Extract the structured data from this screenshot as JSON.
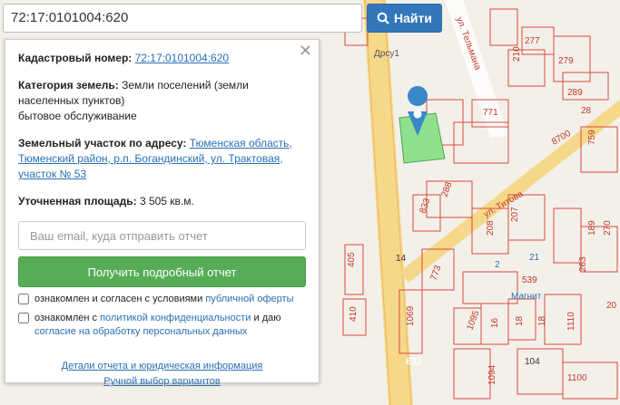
{
  "search": {
    "value": "72:17:0101004:620",
    "button_label": "Найти"
  },
  "panel": {
    "cadastral_label": "Кадастровый номер:",
    "cadastral_value": "72:17:0101004:620",
    "category_label": "Категория земель:",
    "category_value": "Земли поселений (земли населенных пунктов)",
    "usage": "бытовое обслуживание",
    "address_label": "Земельный участок по адресу:",
    "address_value": "Тюменская область, Тюменский район, р.п. Богандинский, ул. Трактовая, участок № 53",
    "area_label": "Уточненная площадь:",
    "area_value": "3 505 кв.м.",
    "email_placeholder": "Ваш email, куда отправить отчет",
    "report_button": "Получить подробный отчет",
    "consent1_text": "ознакомлен и согласен с условиями ",
    "consent1_link": "публичной оферты",
    "consent2_text": "ознакомлен с ",
    "consent2_link": "политикой конфиденциальности",
    "consent2_mid": " и даю ",
    "consent2_link2": "согласие на обработку персональных данных",
    "details_link": "Детали отчета и юридическая информация",
    "manual_link": "Ручной выбор вариантов"
  },
  "map": {
    "labels": [
      "Дрсу1",
      "ул. Тельмана",
      "210",
      "277",
      "279",
      "289",
      "28",
      "771",
      "8700",
      "759",
      "288",
      "833",
      "ул. Титова",
      "208",
      "207",
      "773",
      "405",
      "14",
      "410",
      "1069",
      "1095",
      "16",
      "18",
      "1110",
      "539",
      "Магнит",
      "104",
      "1094",
      "1100",
      "E22",
      "189",
      "270",
      "263",
      "18",
      "20",
      "21",
      "2"
    ]
  },
  "colors": {
    "accent": "#3377bb",
    "success": "#57ad57",
    "parcel": "#8ee08e",
    "marker": "#3a87c8"
  }
}
